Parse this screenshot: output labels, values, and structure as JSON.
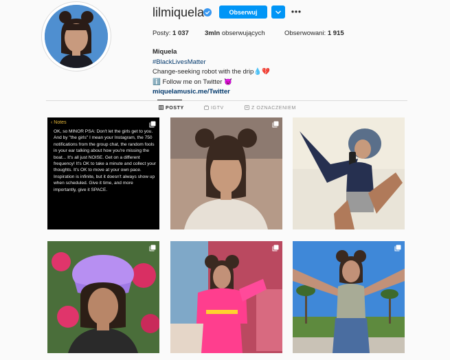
{
  "profile": {
    "username": "lilmiquela",
    "verified_icon": "verified-badge-icon",
    "follow_label": "Obserwuj",
    "dropdown_icon": "chevron-down-icon",
    "more_icon": "more-options-icon"
  },
  "stats": {
    "posts_label": "Posty:",
    "posts_value": "1 037",
    "followers_value": "3mln",
    "followers_label": "obserwujących",
    "following_label": "Obserwowani:",
    "following_value": "1 915"
  },
  "bio": {
    "name": "Miquela",
    "hashtag": "#BlackLivesMatter",
    "line1": "Change-seeking robot with the drip💧💔",
    "line2": "ℹ️ Follow me on Twitter 😈",
    "link": "miquelamusic.me/Twitter"
  },
  "tabs": [
    {
      "label": "POSTY",
      "icon": "grid-icon",
      "active": true
    },
    {
      "label": "IGTV",
      "icon": "igtv-icon",
      "active": false
    },
    {
      "label": "Z OZNACZENIEM",
      "icon": "tagged-icon",
      "active": false
    }
  ],
  "posts": [
    {
      "type": "notes",
      "header": "Notes",
      "text": "OK, so MINOR PSA: Don't let the girls get to you. And by \"the girls\" I mean your Instagram, the 750 notifications from the group chat, the random fools in your ear talking about how you're missing the boat... It's all just NOISE. Get on a different frequency! It's OK to take a minute and collect your thoughts. It's OK to move at your own pace. Inspiration is infinite, but it doesn't always show up when scheduled. Give it time, and more importantly, give it SPACE.",
      "multi": true
    },
    {
      "type": "photo",
      "multi": true
    },
    {
      "type": "photo",
      "multi": false
    },
    {
      "type": "photo",
      "multi": true
    },
    {
      "type": "photo",
      "multi": true
    },
    {
      "type": "photo",
      "multi": true
    }
  ],
  "colors": {
    "accent": "#0095f6",
    "link": "#00376b",
    "notes_accent": "#e6b83b"
  }
}
